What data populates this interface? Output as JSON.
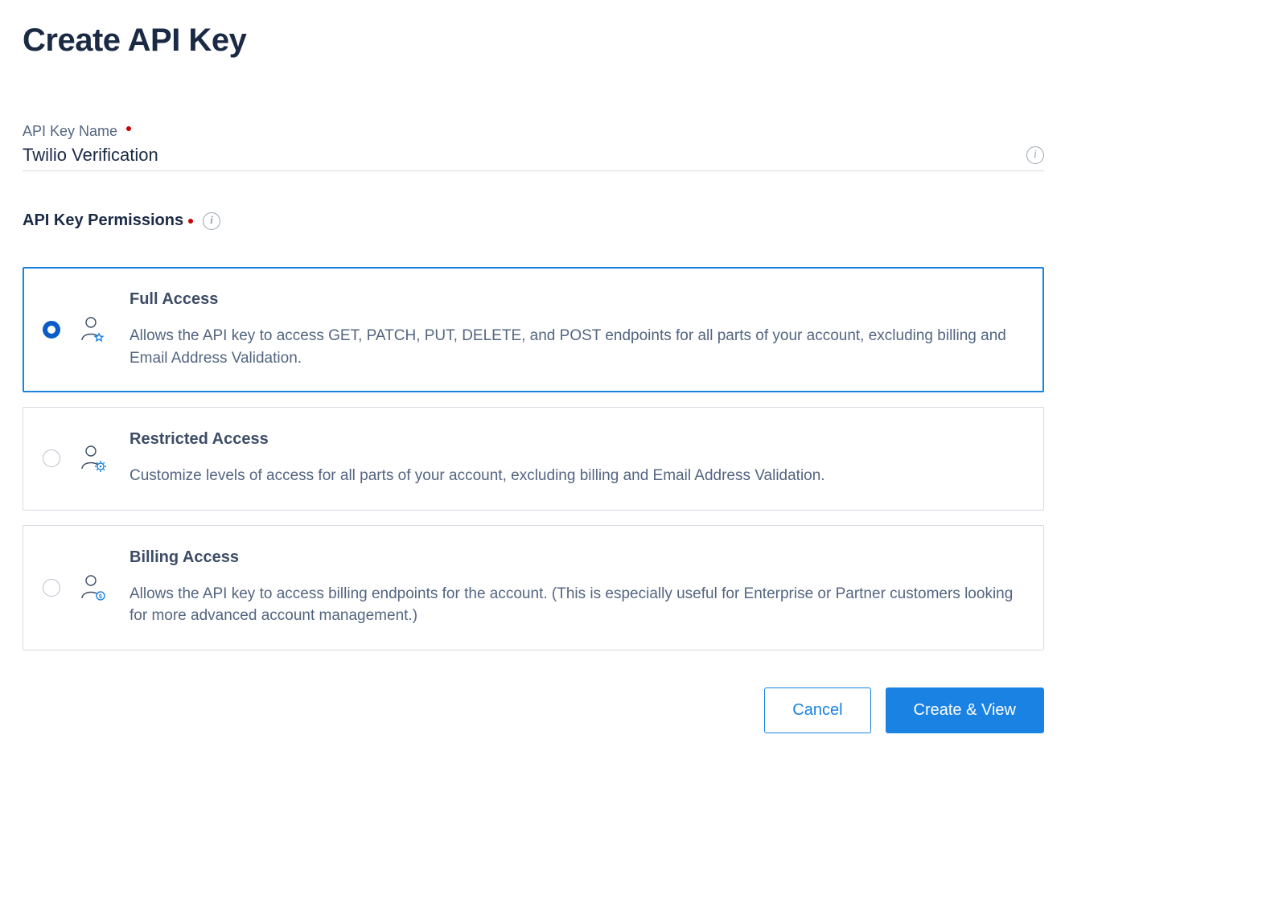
{
  "page": {
    "title": "Create API Key"
  },
  "fields": {
    "name_label": "API Key Name",
    "name_value": "Twilio Verification"
  },
  "permissions": {
    "label": "API Key Permissions",
    "options": [
      {
        "id": "full",
        "title": "Full Access",
        "description": "Allows the API key to access GET, PATCH, PUT, DELETE, and POST endpoints for all parts of your account, excluding billing and Email Address Validation.",
        "selected": true
      },
      {
        "id": "restricted",
        "title": "Restricted Access",
        "description": "Customize levels of access for all parts of your account, excluding billing and Email Address Validation.",
        "selected": false
      },
      {
        "id": "billing",
        "title": "Billing Access",
        "description": "Allows the API key to access billing endpoints for the account. (This is especially useful for Enterprise or Partner customers looking for more advanced account management.)",
        "selected": false
      }
    ]
  },
  "buttons": {
    "cancel": "Cancel",
    "create": "Create & View"
  }
}
